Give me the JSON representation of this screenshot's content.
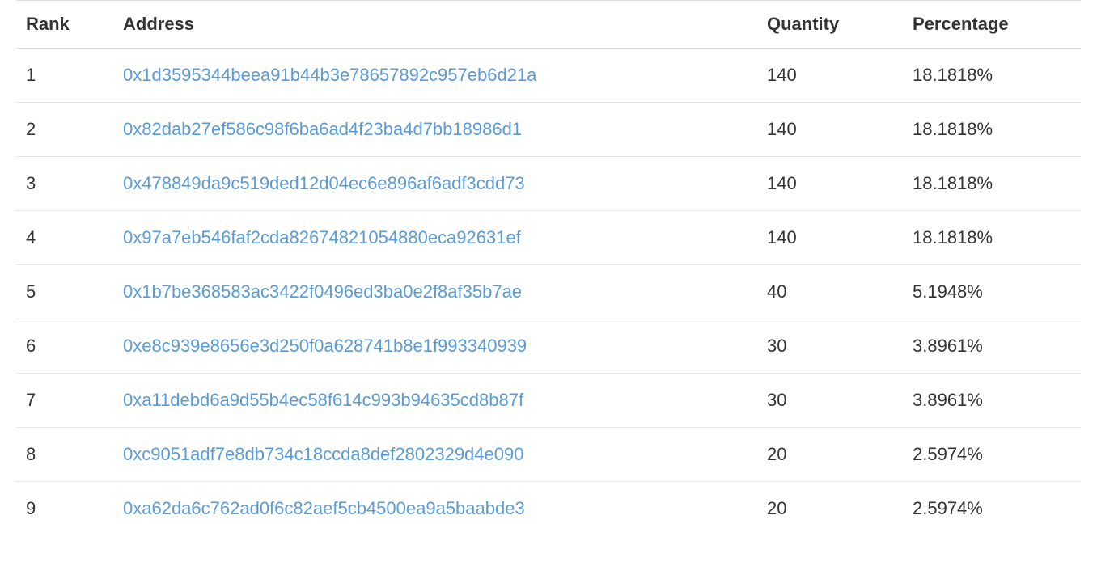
{
  "table": {
    "headers": {
      "rank": "Rank",
      "address": "Address",
      "quantity": "Quantity",
      "percentage": "Percentage"
    },
    "rows": [
      {
        "rank": "1",
        "address": "0x1d3595344beea91b44b3e78657892c957eb6d21a",
        "quantity": "140",
        "percentage": "18.1818%"
      },
      {
        "rank": "2",
        "address": "0x82dab27ef586c98f6ba6ad4f23ba4d7bb18986d1",
        "quantity": "140",
        "percentage": "18.1818%"
      },
      {
        "rank": "3",
        "address": "0x478849da9c519ded12d04ec6e896af6adf3cdd73",
        "quantity": "140",
        "percentage": "18.1818%"
      },
      {
        "rank": "4",
        "address": "0x97a7eb546faf2cda82674821054880eca92631ef",
        "quantity": "140",
        "percentage": "18.1818%"
      },
      {
        "rank": "5",
        "address": "0x1b7be368583ac3422f0496ed3ba0e2f8af35b7ae",
        "quantity": "40",
        "percentage": "5.1948%"
      },
      {
        "rank": "6",
        "address": "0xe8c939e8656e3d250f0a628741b8e1f993340939",
        "quantity": "30",
        "percentage": "3.8961%"
      },
      {
        "rank": "7",
        "address": "0xa11debd6a9d55b4ec58f614c993b94635cd8b87f",
        "quantity": "30",
        "percentage": "3.8961%"
      },
      {
        "rank": "8",
        "address": "0xc9051adf7e8db734c18ccda8def2802329d4e090",
        "quantity": "20",
        "percentage": "2.5974%"
      },
      {
        "rank": "9",
        "address": "0xa62da6c762ad0f6c82aef5cb4500ea9a5baabde3",
        "quantity": "20",
        "percentage": "2.5974%"
      }
    ]
  }
}
